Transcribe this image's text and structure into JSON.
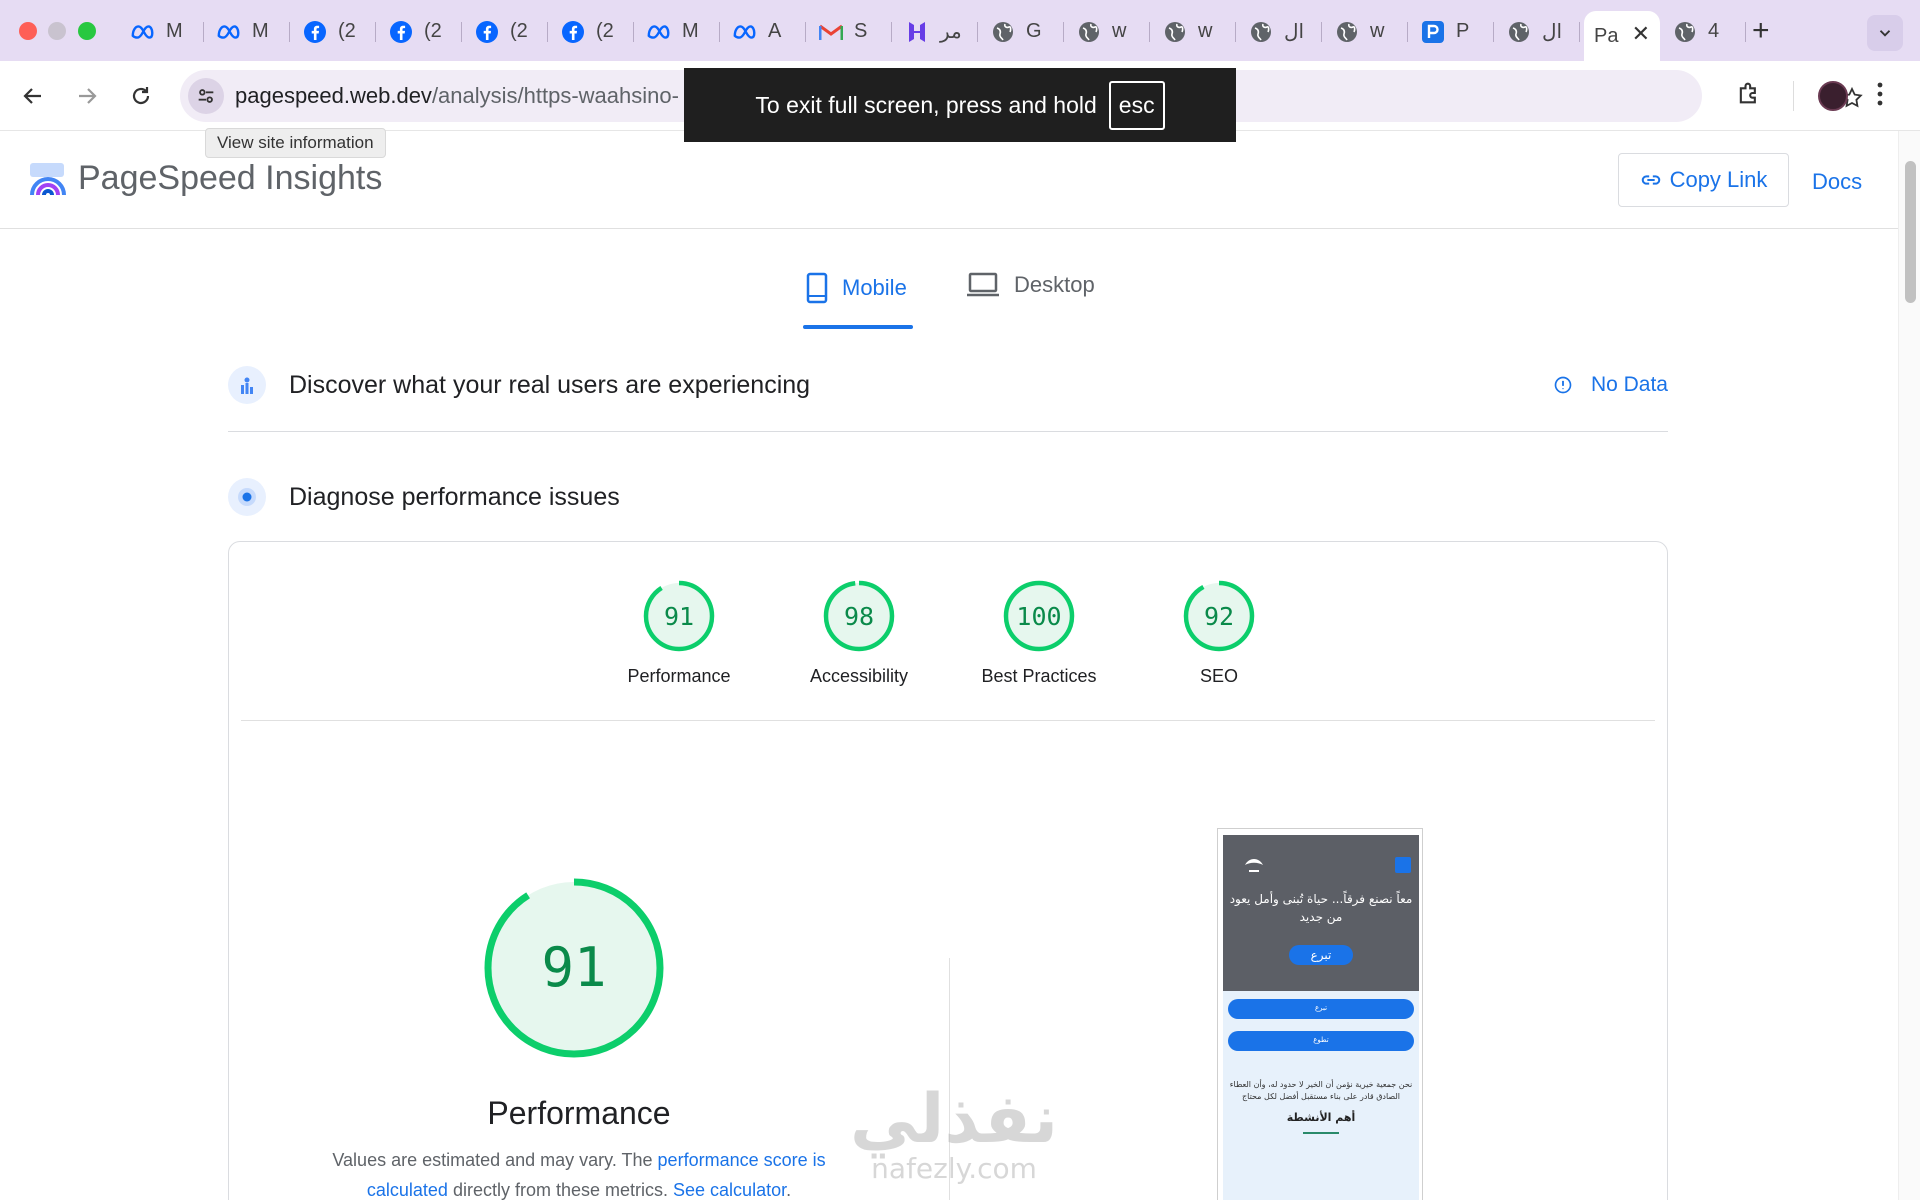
{
  "browser": {
    "tabs": [
      {
        "label": "M",
        "icon": "meta-icon"
      },
      {
        "label": "M",
        "icon": "meta-icon"
      },
      {
        "label": "(2",
        "icon": "facebook-icon"
      },
      {
        "label": "(2",
        "icon": "facebook-icon"
      },
      {
        "label": "(2",
        "icon": "facebook-icon"
      },
      {
        "label": "(2",
        "icon": "facebook-icon"
      },
      {
        "label": "M",
        "icon": "meta-icon"
      },
      {
        "label": "A",
        "icon": "meta-icon"
      },
      {
        "label": "S",
        "icon": "gmail-icon"
      },
      {
        "label": "مر",
        "icon": "hostinger-icon"
      },
      {
        "label": "G",
        "icon": "globe-icon"
      },
      {
        "label": "w",
        "icon": "globe-icon"
      },
      {
        "label": "w",
        "icon": "globe-icon"
      },
      {
        "label": "ال",
        "icon": "globe-icon"
      },
      {
        "label": "w",
        "icon": "globe-icon"
      },
      {
        "label": "P",
        "icon": "pagespeed-p-icon"
      },
      {
        "label": "ال",
        "icon": "globe-icon"
      },
      {
        "label": "Pa",
        "icon": "none",
        "active": true
      },
      {
        "label": "4",
        "icon": "globe-icon"
      }
    ],
    "url_host": "pagespeed.web.dev",
    "url_path": "/analysis/https-waahsino-",
    "tooltip": "View site information",
    "fullscreen_notice": "To exit full screen, press and hold",
    "fullscreen_key": "esc"
  },
  "header": {
    "brand": "PageSpeed Insights",
    "copy_link": "Copy Link",
    "docs": "Docs"
  },
  "device_tabs": {
    "mobile": "Mobile",
    "desktop": "Desktop",
    "selected": "mobile"
  },
  "real_users": {
    "title": "Discover what your real users are experiencing",
    "status": "No Data"
  },
  "diagnose": {
    "title": "Diagnose performance issues"
  },
  "scores": [
    {
      "label": "Performance",
      "value": "91",
      "fraction": 0.91
    },
    {
      "label": "Accessibility",
      "value": "98",
      "fraction": 0.98
    },
    {
      "label": "Best Practices",
      "value": "100",
      "fraction": 1.0
    },
    {
      "label": "SEO",
      "value": "92",
      "fraction": 0.92
    }
  ],
  "performance": {
    "score": "91",
    "fraction": 0.91,
    "title": "Performance",
    "desc_1": "Values are estimated and may vary. The ",
    "desc_link1": "performance score is calculated",
    "desc_2": " directly from these metrics. ",
    "desc_link2": "See calculator",
    "desc_3": "."
  },
  "screenshot_preview": {
    "headline": "معاً نصنع فرقاً... حياة تُبنى وأمل يعود من جديد",
    "cta": "تبرع",
    "button1": "تبرع",
    "button2": "تطوع",
    "body_text": "نحن جمعية خيرية نؤمن أن الخير لا حدود له، وأن العطاء الصادق قادر على بناء مستقبل أفضل لكل محتاج",
    "section_title": "أهم الأنشطة"
  },
  "watermark": {
    "arabic": "نفذلي",
    "latin": "nafezly.com"
  },
  "colors": {
    "pass_green": "#0cce6b",
    "pass_bg": "#e6f7ee",
    "link_blue": "#1a73e8",
    "tabstrip": "#e6dcf3"
  }
}
